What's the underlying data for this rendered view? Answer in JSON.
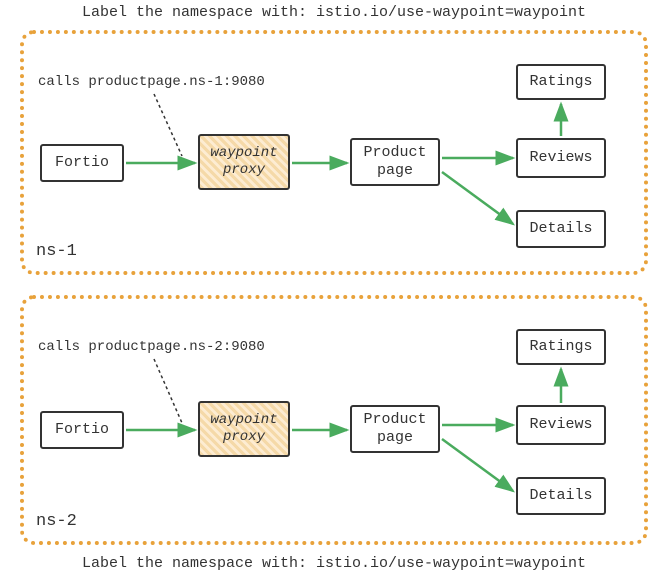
{
  "labels": {
    "top": "Label the namespace with: istio.io/use-waypoint=waypoint",
    "bottom": "Label the namespace with: istio.io/use-waypoint=waypoint"
  },
  "namespaces": [
    {
      "name": "ns-1",
      "call_label": "calls productpage.ns-1:9080",
      "nodes": {
        "fortio": "Fortio",
        "waypoint": "waypoint\nproxy",
        "productpage": "Product\npage",
        "ratings": "Ratings",
        "reviews": "Reviews",
        "details": "Details"
      },
      "edges": [
        [
          "fortio",
          "waypoint"
        ],
        [
          "waypoint",
          "productpage"
        ],
        [
          "productpage",
          "reviews"
        ],
        [
          "productpage",
          "details"
        ],
        [
          "reviews",
          "ratings"
        ]
      ]
    },
    {
      "name": "ns-2",
      "call_label": "calls productpage.ns-2:9080",
      "nodes": {
        "fortio": "Fortio",
        "waypoint": "waypoint\nproxy",
        "productpage": "Product\npage",
        "ratings": "Ratings",
        "reviews": "Reviews",
        "details": "Details"
      },
      "edges": [
        [
          "fortio",
          "waypoint"
        ],
        [
          "waypoint",
          "productpage"
        ],
        [
          "productpage",
          "reviews"
        ],
        [
          "productpage",
          "details"
        ],
        [
          "reviews",
          "ratings"
        ]
      ]
    }
  ],
  "colors": {
    "border_dotted": "#e8a23b",
    "arrow": "#4aab5e",
    "node_border": "#333",
    "waypoint_fill_light": "#fdecd2",
    "waypoint_fill_dark": "#f5d9a8"
  }
}
